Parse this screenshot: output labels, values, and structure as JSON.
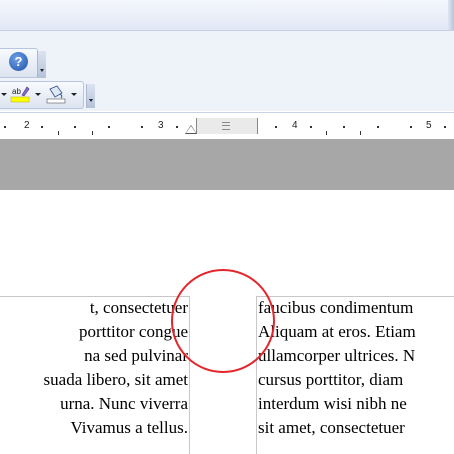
{
  "toolbar": {
    "help_label": "?",
    "icons": [
      "help-icon",
      "highlight-icon",
      "shading-icon",
      "toolbar-options-chevron-icon"
    ],
    "colors": {
      "highlight": "#ffff00",
      "help": "#1d4fa8"
    }
  },
  "ruler": {
    "numbers": [
      "2",
      "3",
      "4",
      "5"
    ]
  },
  "document": {
    "left_column": [
      "t, consectetuer",
      "porttitor congue",
      "na sed pulvinar",
      "suada libero, sit amet",
      "urna. Nunc viverra",
      "Vivamus a tellus."
    ],
    "right_column": [
      "faucibus condimentum",
      "Aliquam at eros. Etiam",
      "ullamcorper ultrices. N",
      "cursus porttitor, diam",
      "interdum wisi nibh ne",
      "sit amet, consectetuer"
    ],
    "annotation_color": "#e4262c"
  }
}
